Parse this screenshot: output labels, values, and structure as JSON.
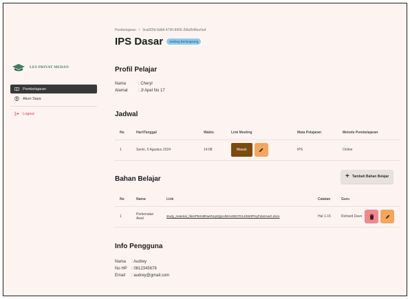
{
  "sidebar": {
    "brand": "LES PRIVAT MEDAN",
    "items": [
      {
        "label": "Pembelajaran",
        "icon": "book-icon",
        "active": true
      },
      {
        "label": "Akun Saya",
        "icon": "user-circle-icon",
        "active": false
      }
    ],
    "logout": "Logout"
  },
  "breadcrumb": {
    "parent": "Pembelajaran",
    "separator": "/",
    "current": "9ca0f2fd-8db8-4790-8906-2dbd548ac0a4"
  },
  "header": {
    "title": "IPS Dasar",
    "status": "Sedang Berlangsung"
  },
  "profile": {
    "title": "Profil Pelajar",
    "rows": [
      {
        "label": "Nama",
        "value": ": Cheryl"
      },
      {
        "label": "Alamat",
        "value": ": Jl Apel No 17"
      }
    ]
  },
  "schedule": {
    "title": "Jadwal",
    "headers": [
      "No",
      "Hari/Tanggal",
      "Waktu",
      "Link Meeting",
      "Mata Pelajaran",
      "Metode Pembelajaran"
    ],
    "rows": [
      {
        "no": "1",
        "date": "Senin, 5 Agustus 2024",
        "time": "14:08",
        "join_label": "Masuk",
        "subject": "IPS",
        "method": "Online"
      }
    ]
  },
  "materials": {
    "title": "Bahan Belajar",
    "add_label": "Tambah Bahan Belajar",
    "headers": [
      "No",
      "Nama",
      "Link",
      "Catatan",
      "Guru"
    ],
    "rows": [
      {
        "no": "1",
        "name": "Perkenalan Awal",
        "link": "study_material_files/P82o9RaeRJqSQpnJMAs39O7D143W3PHyFdaSAwG.docx",
        "note": "Hal 1-15",
        "teacher": "Richard Dave"
      }
    ]
  },
  "user_info": {
    "title": "Info Pengguna",
    "rows": [
      {
        "label": "Nama",
        "value": ": Audrey"
      },
      {
        "label": "No HP",
        "value": ": 0812345678"
      },
      {
        "label": "Email",
        "value": ": audrey@gmail.com"
      }
    ]
  },
  "colors": {
    "background": "#fdf4f1",
    "brand": "#3c7d5b",
    "active_nav": "#383838",
    "join_button": "#7b4a0e",
    "edit_button": "#f3a65c",
    "delete_button": "#f0898d",
    "status_badge": "#8fc9ec",
    "logout": "#d8394a"
  }
}
